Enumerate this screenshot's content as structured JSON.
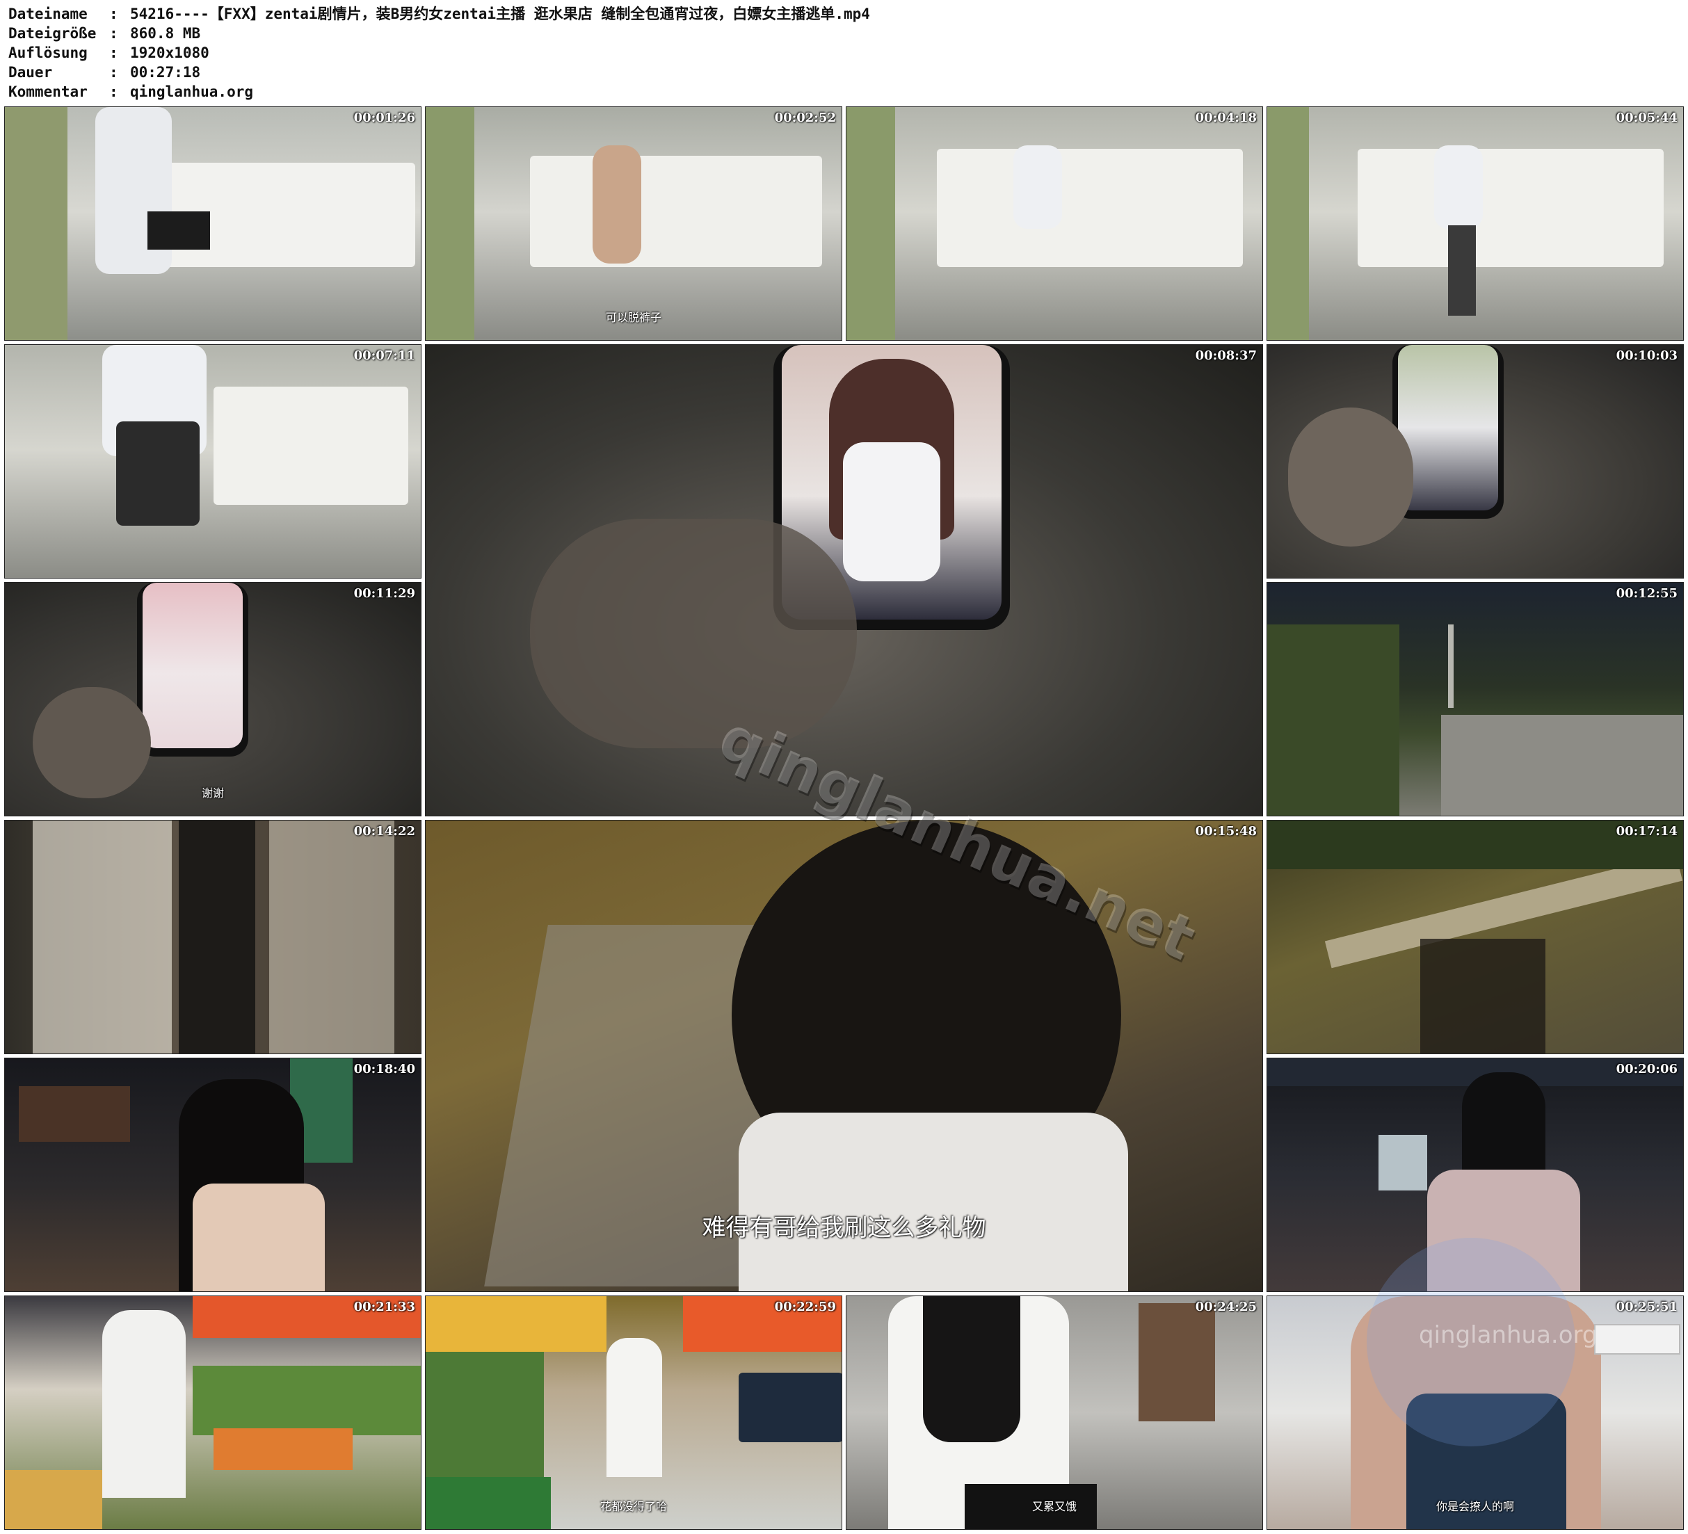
{
  "meta": {
    "filename_label": "Dateiname",
    "filename_value": "54216----【FXX】zentai剧情片，装B男约女zentai主播 逛水果店 缝制全包通宵过夜，白嫖女主播逃单.mp4",
    "size_label": "Dateigröße",
    "size_value": "860.8 MB",
    "resolution_label": "Auflösung",
    "resolution_value": "1920x1080",
    "duration_label": "Dauer",
    "duration_value": "00:27:18",
    "comment_label": "Kommentar",
    "comment_value": "qinglanhua.org",
    "separator": ":"
  },
  "thumbnails": [
    {
      "timestamp": "00:01:26",
      "caption": ""
    },
    {
      "timestamp": "00:02:52",
      "caption": "可以脱裤子"
    },
    {
      "timestamp": "00:04:18",
      "caption": ""
    },
    {
      "timestamp": "00:05:44",
      "caption": ""
    },
    {
      "timestamp": "00:07:11",
      "caption": ""
    },
    {
      "timestamp": "00:08:37",
      "caption": ""
    },
    {
      "timestamp": "00:10:03",
      "caption": ""
    },
    {
      "timestamp": "00:11:29",
      "caption": "谢谢"
    },
    {
      "timestamp": "00:12:55",
      "caption": ""
    },
    {
      "timestamp": "00:14:22",
      "caption": ""
    },
    {
      "timestamp": "00:15:48",
      "caption": "难得有哥给我刷这么多礼物"
    },
    {
      "timestamp": "00:17:14",
      "caption": ""
    },
    {
      "timestamp": "00:18:40",
      "caption": ""
    },
    {
      "timestamp": "00:20:06",
      "caption": ""
    },
    {
      "timestamp": "00:21:33",
      "caption": ""
    },
    {
      "timestamp": "00:22:59",
      "caption": "花都没得了哈"
    },
    {
      "timestamp": "00:24:25",
      "caption": "又累又饿"
    },
    {
      "timestamp": "00:25:51",
      "caption": "你是会撩人的啊"
    }
  ],
  "watermark": {
    "text": "qinglanhua.net",
    "corner_text": "qinglanhua.org"
  }
}
